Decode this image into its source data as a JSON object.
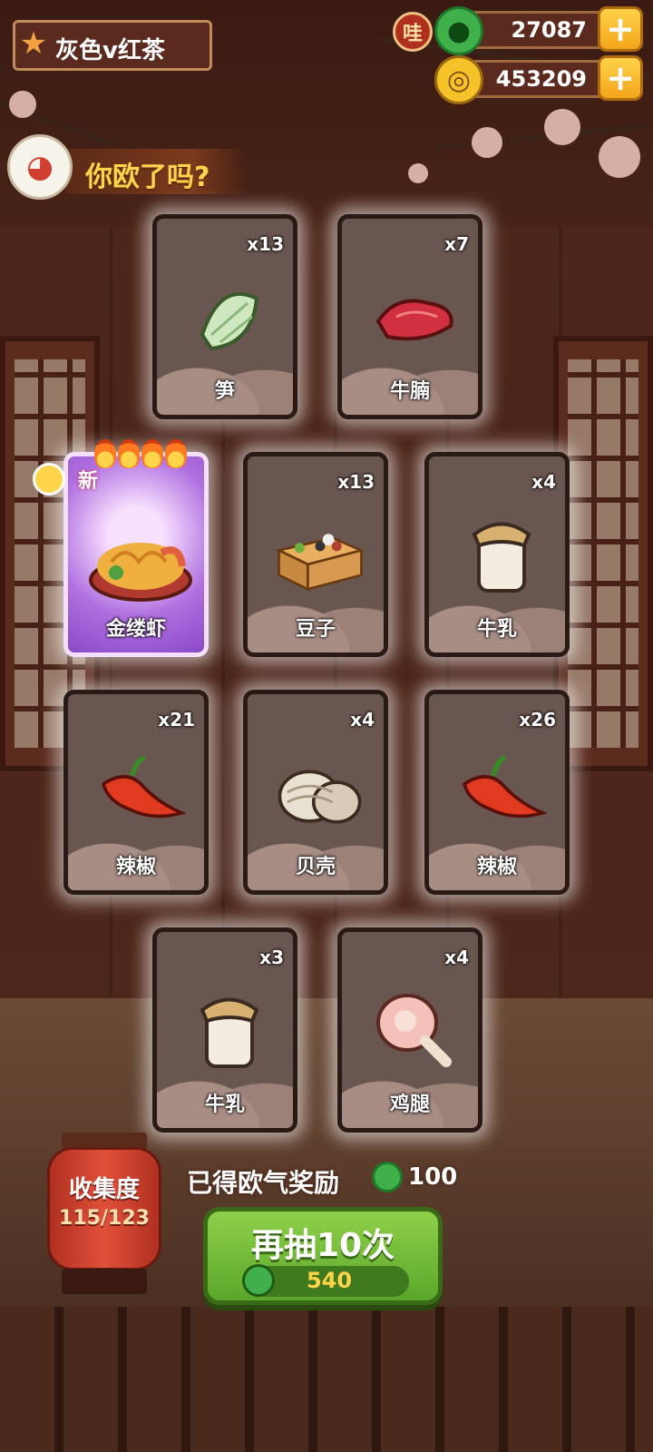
{
  "player": {
    "name": "灰色v红茶"
  },
  "currency": {
    "jade": {
      "badge": "哇",
      "value": "27087"
    },
    "coins": {
      "value": "453209"
    }
  },
  "banner": {
    "text": "你欧了吗?"
  },
  "cards": [
    {
      "name": "笋",
      "qty": "x13",
      "icon": "bamboo-shoot-icon"
    },
    {
      "name": "牛腩",
      "qty": "x7",
      "icon": "beef-brisket-icon"
    },
    {
      "name": "金缕虾",
      "qty": "",
      "icon": "golden-shrimp-noodle-icon",
      "new_label": "新",
      "special": true
    },
    {
      "name": "豆子",
      "qty": "x13",
      "icon": "beans-box-icon"
    },
    {
      "name": "牛乳",
      "qty": "x4",
      "icon": "milk-jar-icon"
    },
    {
      "name": "辣椒",
      "qty": "x21",
      "icon": "chili-pepper-icon"
    },
    {
      "name": "贝壳",
      "qty": "x4",
      "icon": "clam-shell-icon"
    },
    {
      "name": "辣椒",
      "qty": "x26",
      "icon": "chili-pepper-icon"
    },
    {
      "name": "牛乳",
      "qty": "x3",
      "icon": "milk-jar-icon"
    },
    {
      "name": "鸡腿",
      "qty": "x4",
      "icon": "chicken-leg-icon"
    }
  ],
  "collection": {
    "label": "收集度",
    "progress": "115/123"
  },
  "reward": {
    "label": "已得欧气奖励",
    "value": "100"
  },
  "draw_button": {
    "label": "再抽10次",
    "cost": "540"
  }
}
